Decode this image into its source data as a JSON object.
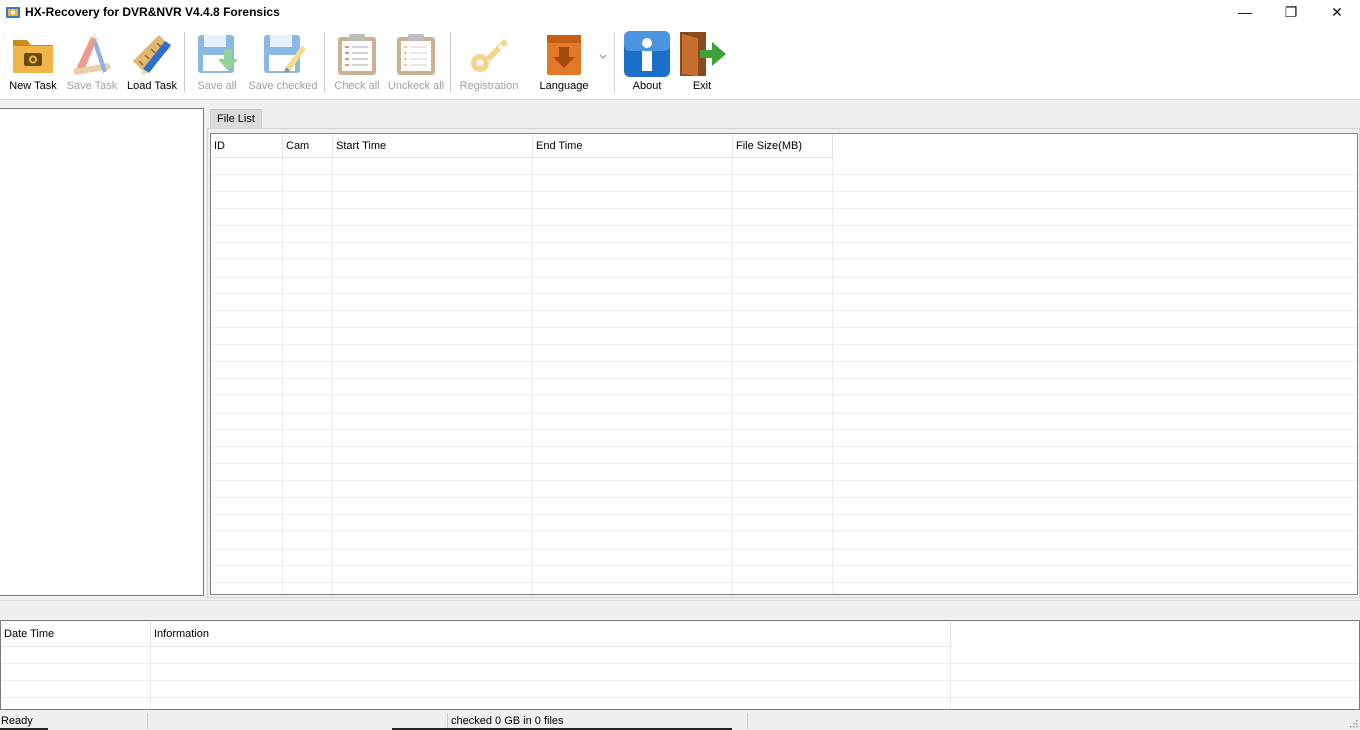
{
  "window": {
    "title": "HX-Recovery for DVR&NVR  V4.4.8 Forensics",
    "minimize_glyph": "—",
    "maximize_glyph": "❐",
    "close_glyph": "✕"
  },
  "toolbar": {
    "new_task": "New Task",
    "save_task": "Save Task",
    "load_task": "Load Task",
    "save_all": "Save all",
    "save_checked": "Save checked",
    "check_all": "Check all",
    "uncheck_all": "Unckeck all",
    "registration": "Registration",
    "language": "Language",
    "about": "About",
    "exit": "Exit",
    "icons": {
      "new_task": "folder-camera-icon",
      "save_task": "pencil-ruler-icon",
      "load_task": "pencil-ruler-icon",
      "save_all": "floppy-download-icon",
      "save_checked": "floppy-pencil-icon",
      "check_all": "clipboard-checklist-icon",
      "uncheck_all": "clipboard-blank-icon",
      "registration": "key-icon",
      "language": "box-download-icon",
      "about": "info-icon",
      "exit": "exit-door-icon"
    }
  },
  "tabs": [
    {
      "label": "File List",
      "active": true
    }
  ],
  "file_list": {
    "columns": [
      "ID",
      "Cam",
      "Start Time",
      "End Time",
      "File Size(MB)"
    ],
    "rows": []
  },
  "log_list": {
    "columns": [
      "Date Time",
      "Information"
    ],
    "rows": []
  },
  "status_bar": {
    "state": "Ready",
    "summary": "checked 0 GB in 0 files"
  },
  "colors": {
    "accent_blue": "#1a6fc9",
    "folder_orange": "#e8a33a",
    "exit_green": "#3aa33a",
    "disabled_text": "#a0a0a0"
  }
}
